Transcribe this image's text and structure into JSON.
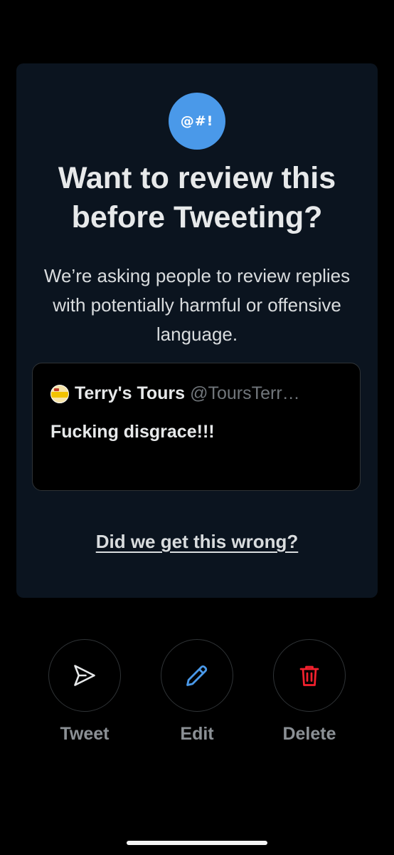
{
  "dialog": {
    "badge_text": "@#!",
    "title": "Want to review this before Tweeting?",
    "subtitle": "We’re asking people to review replies with potentially harmful or offensive language.",
    "quote": {
      "author_name": "Terry's Tours",
      "author_handle": "@ToursTerr…",
      "text": "Fucking disgrace!!!"
    },
    "feedback_link": "Did we get this wrong?"
  },
  "actions": {
    "tweet_label": "Tweet",
    "edit_label": "Edit",
    "delete_label": "Delete"
  },
  "colors": {
    "badge": "#4a99e9",
    "card_background": "#0b141f",
    "edit_icon": "#4a99e9",
    "delete_icon": "#f4212e",
    "muted_text": "#71767b"
  },
  "icons": {
    "tweet": "send-icon",
    "edit": "pencil-icon",
    "delete": "trash-icon"
  }
}
